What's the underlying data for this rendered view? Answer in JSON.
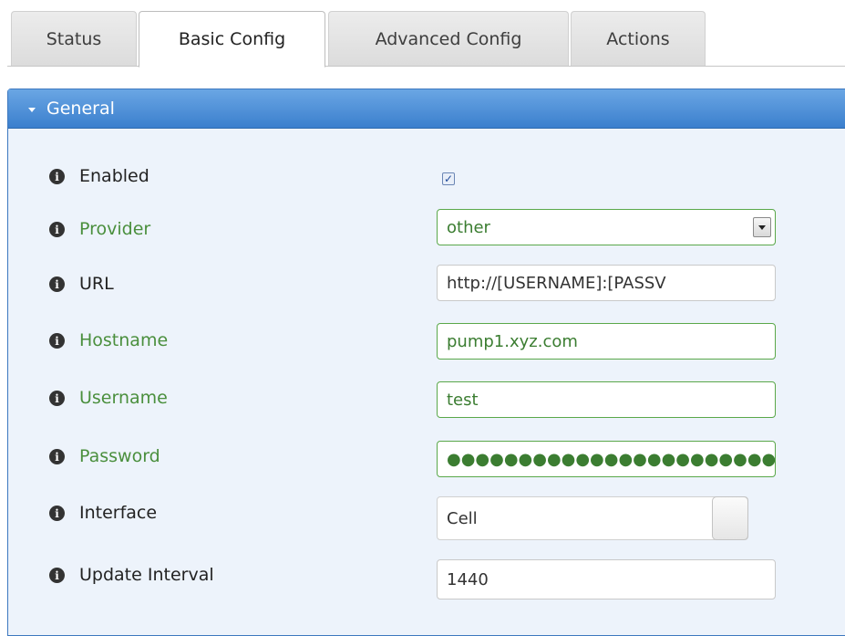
{
  "tabs": [
    {
      "label": "Status"
    },
    {
      "label": "Basic Config"
    },
    {
      "label": "Advanced Config"
    },
    {
      "label": "Actions"
    }
  ],
  "active_tab": "Basic Config",
  "panel": {
    "title": "General"
  },
  "form": {
    "enabled": {
      "label": "Enabled",
      "checked": true
    },
    "provider": {
      "label": "Provider",
      "value": "other"
    },
    "url": {
      "label": "URL",
      "value": "http://[USERNAME]:[PASSV"
    },
    "hostname": {
      "label": "Hostname",
      "value": "pump1.xyz.com"
    },
    "username": {
      "label": "Username",
      "value": "test"
    },
    "password": {
      "label": "Password",
      "masked_value": "●●●●●●●●●●●●●●●●●●●●●●●●"
    },
    "interface": {
      "label": "Interface",
      "value": "Cell"
    },
    "update_interval": {
      "label": "Update Interval",
      "value": "1440"
    }
  },
  "icons": {
    "info": "info-circle-icon",
    "info_glyph": "i",
    "checkmark": "✓"
  },
  "colors": {
    "accent": "#3b7fcd",
    "required_label": "#4a8f3d",
    "panel_bg": "#edf3fb"
  }
}
